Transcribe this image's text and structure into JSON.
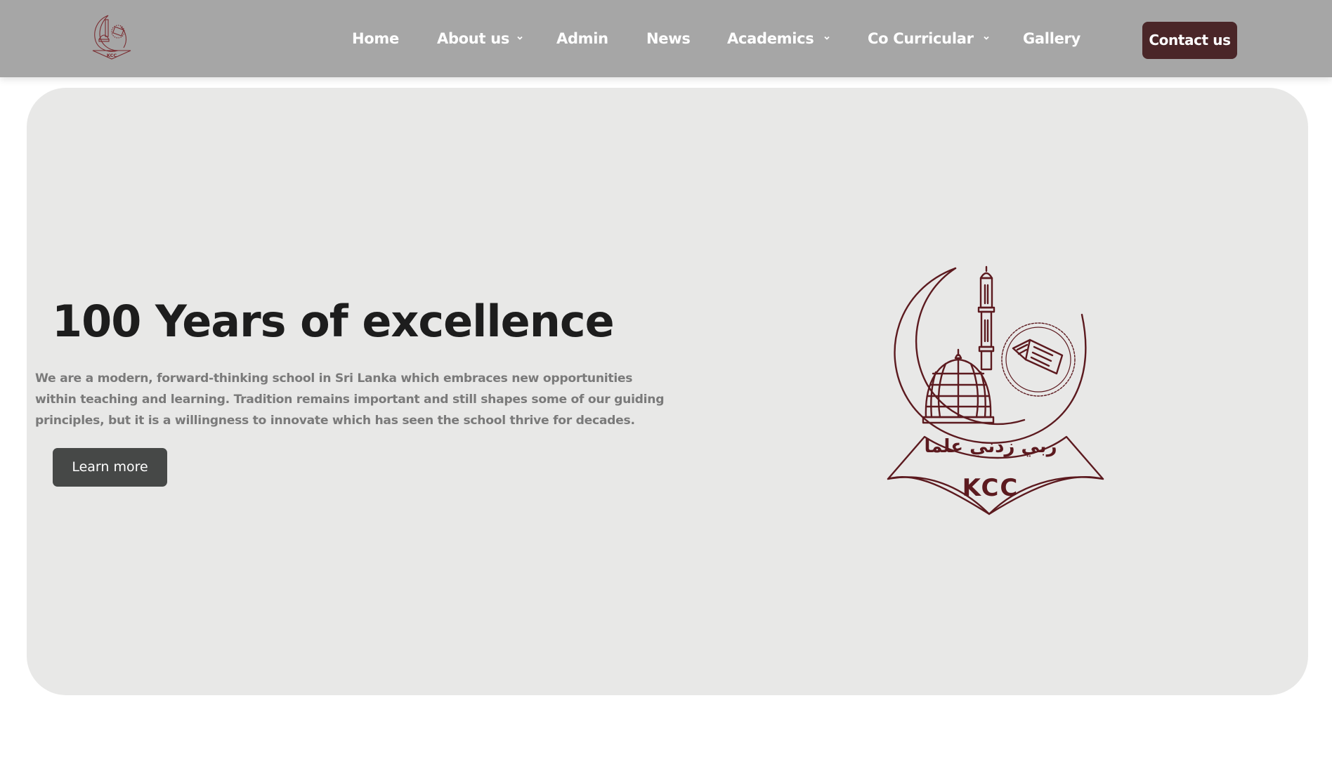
{
  "header": {
    "logo_text": "KCC",
    "nav": [
      {
        "label": "Home"
      },
      {
        "label": "About us"
      },
      {
        "label": "Admin"
      },
      {
        "label": "News"
      },
      {
        "label": "Academics"
      },
      {
        "label": "Co Curricular"
      },
      {
        "label": "Gallery"
      }
    ],
    "contact_label": "Contact us"
  },
  "hero": {
    "title": "100 Years of excellence",
    "description": "We are a modern, forward-thinking school in Sri Lanka which embraces new opportunities within teaching and learning. Tradition remains important and still shapes some of our guiding principles, but it is a willingness to innovate which has seen the school thrive for decades.",
    "cta_label": "Learn more",
    "emblem": {
      "motto": "ربي زدني علما",
      "name": "KCC"
    }
  },
  "colors": {
    "nav_bg": "#a6a6a6",
    "brand_maroon": "#5c1a1f",
    "contact_bg": "#4a2628",
    "hero_bg": "#e8e8e7",
    "button_dark": "#464847"
  }
}
